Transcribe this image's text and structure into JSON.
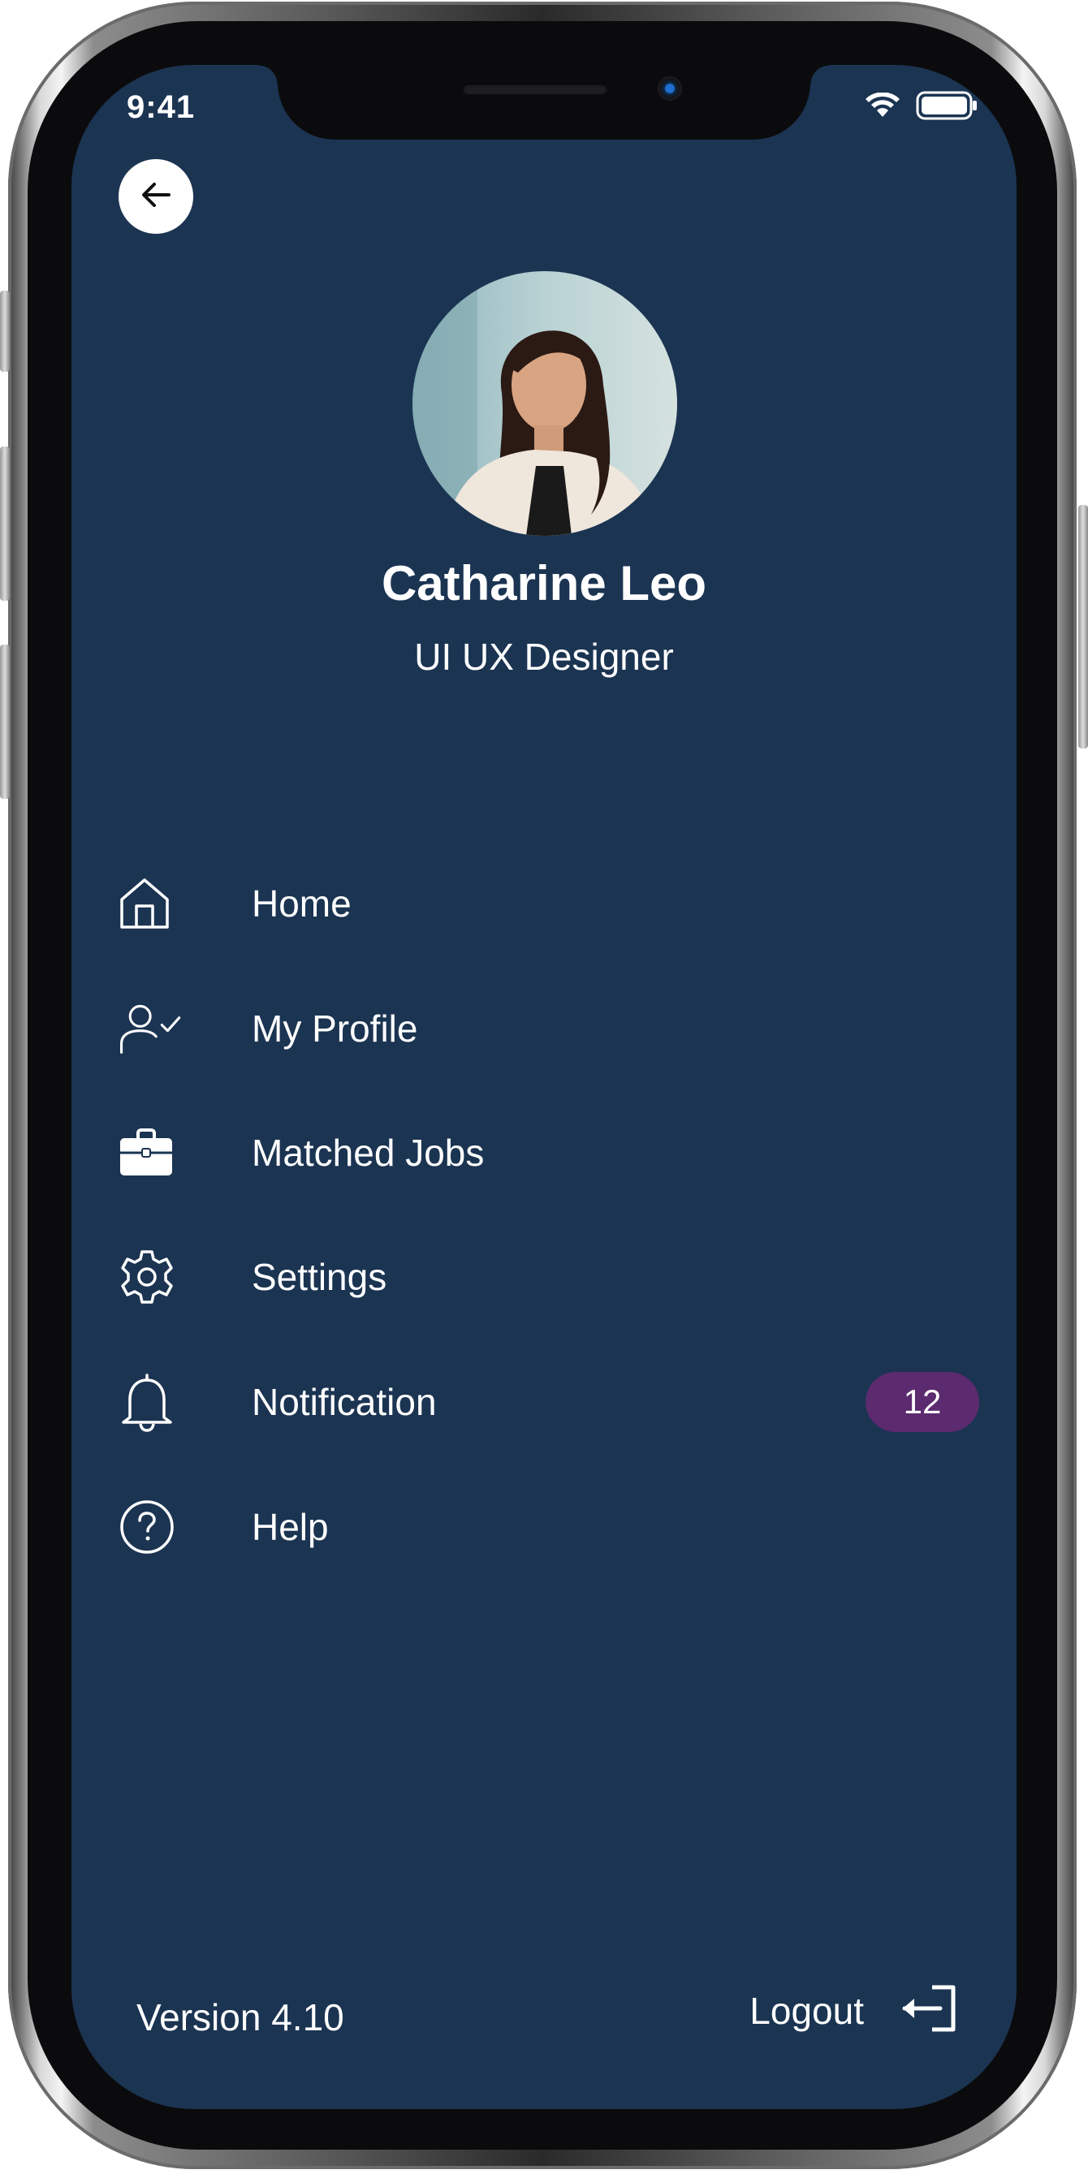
{
  "status_bar": {
    "time": "9:41"
  },
  "header": {
    "back_icon": "arrow-left-icon"
  },
  "profile": {
    "name": "Catharine Leo",
    "role": "UI UX Designer",
    "avatar_alt": "Profile photo"
  },
  "menu": {
    "items": [
      {
        "label": "Home",
        "icon": "home-icon"
      },
      {
        "label": "My Profile",
        "icon": "user-check-icon"
      },
      {
        "label": "Matched Jobs",
        "icon": "briefcase-icon"
      },
      {
        "label": "Settings",
        "icon": "gear-icon"
      },
      {
        "label": "Notification",
        "icon": "bell-icon",
        "badge": "12"
      },
      {
        "label": "Help",
        "icon": "help-circle-icon"
      }
    ]
  },
  "footer": {
    "version": "Version 4.10",
    "logout_label": "Logout",
    "logout_icon": "logout-icon"
  },
  "colors": {
    "background": "#1b3452",
    "badge": "#5c2a6e",
    "text": "#ffffff"
  }
}
